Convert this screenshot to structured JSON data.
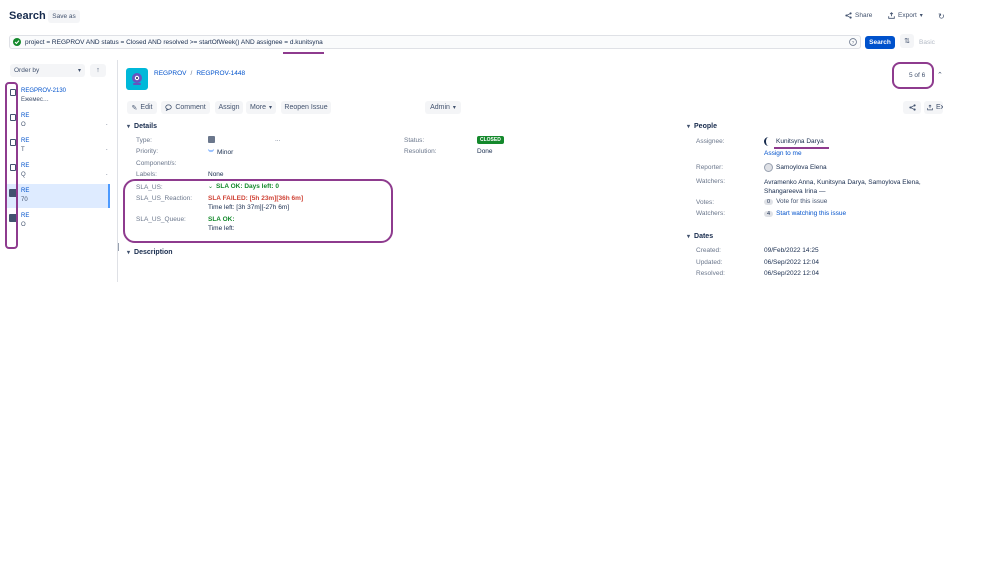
{
  "header": {
    "title": "Search",
    "save_as": "Save as",
    "share": "Share",
    "export": "Export"
  },
  "jql": {
    "query": "project = REGPROV AND status = Closed AND resolved >= startOfWeek() AND assignee = d.kunitsyna",
    "search_btn": "Search",
    "basic": "Basic"
  },
  "list": {
    "order_by": "Order by",
    "items": [
      {
        "key": "REGPROV-2130",
        "summary": "Ежемес…"
      },
      {
        "key": "RE",
        "summary": "О"
      },
      {
        "key": "RE",
        "summary": "Т"
      },
      {
        "key": "RE",
        "summary": "Q"
      },
      {
        "key": "RE",
        "summary": "70"
      },
      {
        "key": "RE",
        "summary": "О"
      }
    ]
  },
  "issue": {
    "project": "REGPROV",
    "key": "REGPROV-1448",
    "pager": "5 of 6",
    "buttons": {
      "edit": "Edit",
      "comment": "Comment",
      "assign": "Assign",
      "more": "More",
      "reopen": "Reopen Issue",
      "admin": "Admin"
    },
    "details": {
      "heading": "Details",
      "type_label": "Type:",
      "type_value": "...",
      "priority_label": "Priority:",
      "priority_value": "Minor",
      "components_label": "Component/s:",
      "labels_label": "Labels:",
      "labels_value": "None",
      "status_label": "Status:",
      "status_value": "CLOSED",
      "resolution_label": "Resolution:",
      "resolution_value": "Done"
    },
    "sla": {
      "us_label": "SLA_US:",
      "us_value": "SLA OK: Days left: 0",
      "reaction_label": "SLA_US_Reaction:",
      "reaction_value": "SLA FAILED: [5h 23m][36h 6m]",
      "reaction_time": "Time left: [3h 37m][-27h 6m]",
      "queue_label": "SLA_US_Queue:",
      "queue_value": "SLA OK:",
      "queue_time": "Time left:"
    },
    "description_heading": "Description",
    "people": {
      "heading": "People",
      "assignee_label": "Assignee:",
      "assignee_value": "Kunitsyna Darya",
      "assign_to_me": "Assign to me",
      "reporter_label": "Reporter:",
      "reporter_value": "Samoylova Elena",
      "watchers_label": "Watchers:",
      "watchers_value": "Avramenko Anna, Kunitsyna Darya, Samoylova Elena, Shangareeva Irina",
      "votes_label": "Votes:",
      "votes_count": "0",
      "vote_link": "Vote for this issue",
      "watchers2_label": "Watchers:",
      "watch_count": "4",
      "watch_link": "Start watching this issue"
    },
    "dates": {
      "heading": "Dates",
      "created_label": "Created:",
      "created_value": "09/Feb/2022 14:25",
      "updated_label": "Updated:",
      "updated_value": "06/Sep/2022 12:04",
      "resolved_label": "Resolved:",
      "resolved_value": "06/Sep/2022 12:04"
    },
    "export_label": "Ex"
  },
  "colors": {
    "accent": "#0052cc",
    "annotation": "#8e3b8e",
    "sla_ok": "#14892c",
    "sla_failed": "#d04437",
    "closed_badge": "#14892c"
  }
}
